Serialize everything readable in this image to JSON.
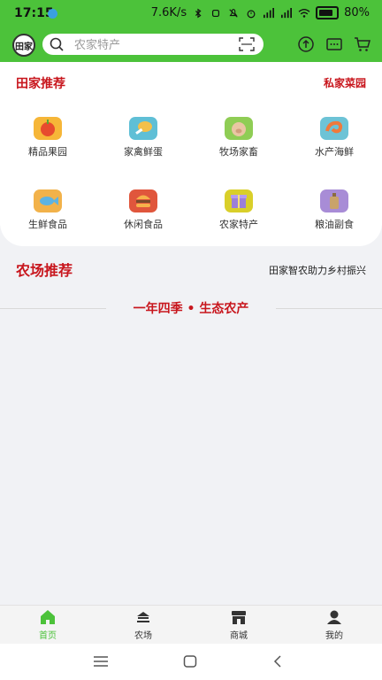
{
  "status_bar": {
    "time": "17:15",
    "network_speed": "7.6K/s",
    "battery": "80%"
  },
  "header": {
    "logo_text": "田家",
    "search_placeholder": "农家特产",
    "icons": [
      "upload-icon",
      "message-icon",
      "cart-icon"
    ]
  },
  "categories_section": {
    "title": "田家推荐",
    "right_link": "私家菜园",
    "items": [
      {
        "label": "精品果园",
        "icon": "apple-icon",
        "color": "#f6b638"
      },
      {
        "label": "家禽鲜蛋",
        "icon": "chicken-leg-icon",
        "color": "#5fbfd6"
      },
      {
        "label": "牧场家畜",
        "icon": "pig-icon",
        "color": "#8fcd55"
      },
      {
        "label": "水产海鲜",
        "icon": "shrimp-icon",
        "color": "#6dc3d6"
      },
      {
        "label": "生鲜食品",
        "icon": "fish-icon",
        "color": "#f2b24a"
      },
      {
        "label": "休闲食品",
        "icon": "burger-icon",
        "color": "#e0563c"
      },
      {
        "label": "农家特产",
        "icon": "gift-box-icon",
        "color": "#d9cf2a"
      },
      {
        "label": "粮油副食",
        "icon": "oil-bottle-icon",
        "color": "#a88cd6"
      }
    ]
  },
  "farm_section": {
    "title": "农场推荐",
    "subtitle": "田家智农助力乡村振兴",
    "slogan": "一年四季 • 生态农产"
  },
  "tab_bar": {
    "tabs": [
      {
        "label": "首页",
        "icon": "home-icon",
        "active": true
      },
      {
        "label": "农场",
        "icon": "farm-icon",
        "active": false
      },
      {
        "label": "商城",
        "icon": "store-icon",
        "active": false
      },
      {
        "label": "我的",
        "icon": "profile-icon",
        "active": false
      }
    ]
  },
  "colors": {
    "brand_green": "#4cc23a",
    "accent_red": "#c8161d",
    "page_bg": "#f1f2f5"
  }
}
